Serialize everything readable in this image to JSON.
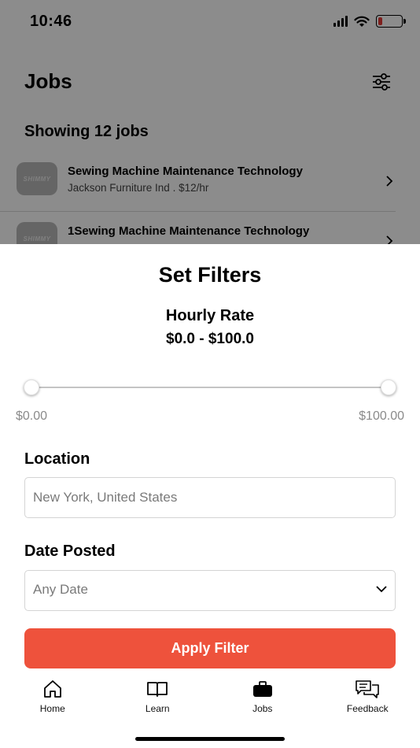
{
  "status_bar": {
    "time": "10:46"
  },
  "header": {
    "title": "Jobs",
    "filter_icon": "sliders-icon"
  },
  "job_count_text": "Showing 12 jobs",
  "jobs": [
    {
      "logo_text": "SHIMMY",
      "title": "Sewing Machine Maintenance Technology",
      "subtitle": "Jackson Furniture Ind . $12/hr"
    },
    {
      "logo_text": "SHIMMY",
      "title": "1Sewing Machine Maintenance Technology",
      "subtitle": ""
    }
  ],
  "filters": {
    "title": "Set Filters",
    "hourly_rate": {
      "label": "Hourly Rate",
      "value_text": "$0.0 - $100.0",
      "range": [
        0,
        100
      ],
      "selected": [
        0,
        100
      ],
      "min_label": "$0.00",
      "max_label": "$100.00"
    },
    "location": {
      "label": "Location",
      "value": "New York, United States"
    },
    "date_posted": {
      "label": "Date Posted",
      "value": "Any Date"
    },
    "apply_label": "Apply Filter"
  },
  "tabs": [
    {
      "label": "Home",
      "icon": "home-icon"
    },
    {
      "label": "Learn",
      "icon": "book-icon"
    },
    {
      "label": "Jobs",
      "icon": "briefcase-icon",
      "active": true
    },
    {
      "label": "Feedback",
      "icon": "chat-icon"
    }
  ],
  "colors": {
    "accent": "#ee523c",
    "battery_low": "#e53935"
  }
}
